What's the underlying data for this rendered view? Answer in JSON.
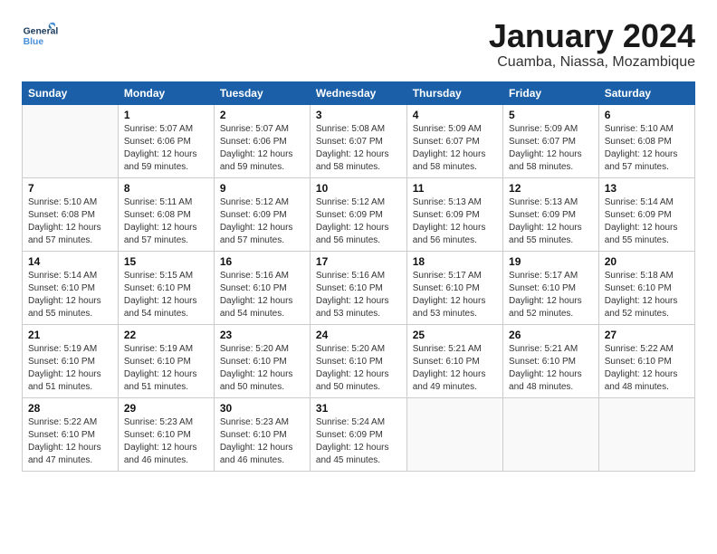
{
  "header": {
    "logo_general": "General",
    "logo_blue": "Blue",
    "title": "January 2024",
    "subtitle": "Cuamba, Niassa, Mozambique"
  },
  "days_of_week": [
    "Sunday",
    "Monday",
    "Tuesday",
    "Wednesday",
    "Thursday",
    "Friday",
    "Saturday"
  ],
  "weeks": [
    [
      {
        "day": "",
        "info": ""
      },
      {
        "day": "1",
        "info": "Sunrise: 5:07 AM\nSunset: 6:06 PM\nDaylight: 12 hours\nand 59 minutes."
      },
      {
        "day": "2",
        "info": "Sunrise: 5:07 AM\nSunset: 6:06 PM\nDaylight: 12 hours\nand 59 minutes."
      },
      {
        "day": "3",
        "info": "Sunrise: 5:08 AM\nSunset: 6:07 PM\nDaylight: 12 hours\nand 58 minutes."
      },
      {
        "day": "4",
        "info": "Sunrise: 5:09 AM\nSunset: 6:07 PM\nDaylight: 12 hours\nand 58 minutes."
      },
      {
        "day": "5",
        "info": "Sunrise: 5:09 AM\nSunset: 6:07 PM\nDaylight: 12 hours\nand 58 minutes."
      },
      {
        "day": "6",
        "info": "Sunrise: 5:10 AM\nSunset: 6:08 PM\nDaylight: 12 hours\nand 57 minutes."
      }
    ],
    [
      {
        "day": "7",
        "info": "Sunrise: 5:10 AM\nSunset: 6:08 PM\nDaylight: 12 hours\nand 57 minutes."
      },
      {
        "day": "8",
        "info": "Sunrise: 5:11 AM\nSunset: 6:08 PM\nDaylight: 12 hours\nand 57 minutes."
      },
      {
        "day": "9",
        "info": "Sunrise: 5:12 AM\nSunset: 6:09 PM\nDaylight: 12 hours\nand 57 minutes."
      },
      {
        "day": "10",
        "info": "Sunrise: 5:12 AM\nSunset: 6:09 PM\nDaylight: 12 hours\nand 56 minutes."
      },
      {
        "day": "11",
        "info": "Sunrise: 5:13 AM\nSunset: 6:09 PM\nDaylight: 12 hours\nand 56 minutes."
      },
      {
        "day": "12",
        "info": "Sunrise: 5:13 AM\nSunset: 6:09 PM\nDaylight: 12 hours\nand 55 minutes."
      },
      {
        "day": "13",
        "info": "Sunrise: 5:14 AM\nSunset: 6:09 PM\nDaylight: 12 hours\nand 55 minutes."
      }
    ],
    [
      {
        "day": "14",
        "info": "Sunrise: 5:14 AM\nSunset: 6:10 PM\nDaylight: 12 hours\nand 55 minutes."
      },
      {
        "day": "15",
        "info": "Sunrise: 5:15 AM\nSunset: 6:10 PM\nDaylight: 12 hours\nand 54 minutes."
      },
      {
        "day": "16",
        "info": "Sunrise: 5:16 AM\nSunset: 6:10 PM\nDaylight: 12 hours\nand 54 minutes."
      },
      {
        "day": "17",
        "info": "Sunrise: 5:16 AM\nSunset: 6:10 PM\nDaylight: 12 hours\nand 53 minutes."
      },
      {
        "day": "18",
        "info": "Sunrise: 5:17 AM\nSunset: 6:10 PM\nDaylight: 12 hours\nand 53 minutes."
      },
      {
        "day": "19",
        "info": "Sunrise: 5:17 AM\nSunset: 6:10 PM\nDaylight: 12 hours\nand 52 minutes."
      },
      {
        "day": "20",
        "info": "Sunrise: 5:18 AM\nSunset: 6:10 PM\nDaylight: 12 hours\nand 52 minutes."
      }
    ],
    [
      {
        "day": "21",
        "info": "Sunrise: 5:19 AM\nSunset: 6:10 PM\nDaylight: 12 hours\nand 51 minutes."
      },
      {
        "day": "22",
        "info": "Sunrise: 5:19 AM\nSunset: 6:10 PM\nDaylight: 12 hours\nand 51 minutes."
      },
      {
        "day": "23",
        "info": "Sunrise: 5:20 AM\nSunset: 6:10 PM\nDaylight: 12 hours\nand 50 minutes."
      },
      {
        "day": "24",
        "info": "Sunrise: 5:20 AM\nSunset: 6:10 PM\nDaylight: 12 hours\nand 50 minutes."
      },
      {
        "day": "25",
        "info": "Sunrise: 5:21 AM\nSunset: 6:10 PM\nDaylight: 12 hours\nand 49 minutes."
      },
      {
        "day": "26",
        "info": "Sunrise: 5:21 AM\nSunset: 6:10 PM\nDaylight: 12 hours\nand 48 minutes."
      },
      {
        "day": "27",
        "info": "Sunrise: 5:22 AM\nSunset: 6:10 PM\nDaylight: 12 hours\nand 48 minutes."
      }
    ],
    [
      {
        "day": "28",
        "info": "Sunrise: 5:22 AM\nSunset: 6:10 PM\nDaylight: 12 hours\nand 47 minutes."
      },
      {
        "day": "29",
        "info": "Sunrise: 5:23 AM\nSunset: 6:10 PM\nDaylight: 12 hours\nand 46 minutes."
      },
      {
        "day": "30",
        "info": "Sunrise: 5:23 AM\nSunset: 6:10 PM\nDaylight: 12 hours\nand 46 minutes."
      },
      {
        "day": "31",
        "info": "Sunrise: 5:24 AM\nSunset: 6:09 PM\nDaylight: 12 hours\nand 45 minutes."
      },
      {
        "day": "",
        "info": ""
      },
      {
        "day": "",
        "info": ""
      },
      {
        "day": "",
        "info": ""
      }
    ]
  ]
}
